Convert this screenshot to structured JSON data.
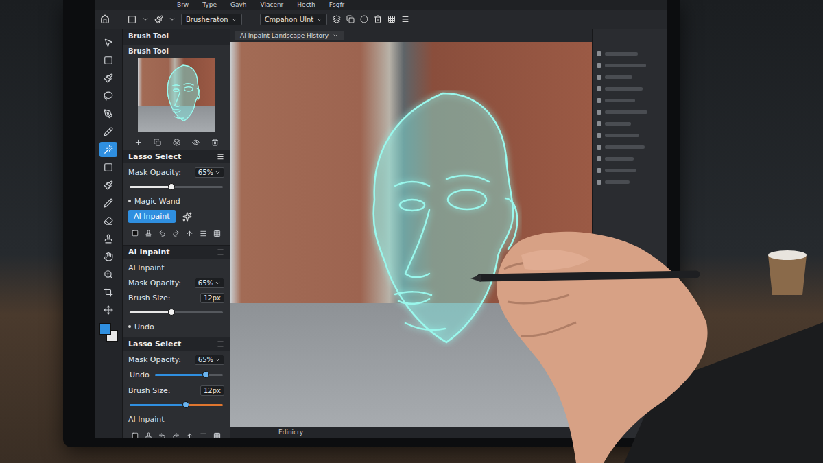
{
  "menu": [
    "Brw",
    "Type",
    "Gavh",
    "Viacenr",
    "Hecth",
    "Fsgfr"
  ],
  "options_bar": {
    "preset": "Brusheraton",
    "mode": "Cmpahon Ulnt"
  },
  "tools": [
    {
      "kind": "pointer",
      "selected": false
    },
    {
      "kind": "marquee",
      "selected": false
    },
    {
      "kind": "brush",
      "selected": false
    },
    {
      "kind": "lasso",
      "selected": false
    },
    {
      "kind": "pen",
      "selected": false
    },
    {
      "kind": "pencil",
      "selected": false
    },
    {
      "kind": "wand",
      "selected": true
    },
    {
      "kind": "marquee",
      "selected": false
    },
    {
      "kind": "brush",
      "selected": false
    },
    {
      "kind": "pencil",
      "selected": false
    },
    {
      "kind": "eraser",
      "selected": false
    },
    {
      "kind": "stamp",
      "selected": false
    },
    {
      "kind": "hand",
      "selected": false
    },
    {
      "kind": "zoom",
      "selected": false
    },
    {
      "kind": "crop",
      "selected": false
    },
    {
      "kind": "move",
      "selected": false
    }
  ],
  "swatch": {
    "foreground": "#2f8fe0",
    "background": "#e8e8e8"
  },
  "document_tab": {
    "title": "AI Inpaint Landscape History"
  },
  "sidebar": {
    "header": "Brush Tool",
    "preview_title": "Brush Tool",
    "sections": [
      {
        "title": "Lasso Select",
        "rows": [
          {
            "kind": "select",
            "label": "Mask Opacity:",
            "value": "65%"
          },
          {
            "kind": "slider",
            "level": 0.45,
            "color": "#e8e8e8",
            "track": "#55585d"
          },
          {
            "kind": "bullet",
            "label": "Magic Wand"
          },
          {
            "kind": "button",
            "label": "AI Inpaint",
            "selected": true
          },
          {
            "kind": "icons"
          }
        ]
      },
      {
        "title": "AI Inpaint",
        "rows": [
          {
            "kind": "label",
            "label": "AI Inpaint"
          },
          {
            "kind": "select",
            "label": "Mask Opacity:",
            "value": "65%"
          },
          {
            "kind": "value",
            "label": "Brush Size:",
            "value": "12px"
          },
          {
            "kind": "slider",
            "level": 0.45,
            "color": "#e8e8e8",
            "track": "#55585d"
          },
          {
            "kind": "bullet",
            "label": "Undo"
          }
        ]
      },
      {
        "title": "Lasso Select",
        "rows": [
          {
            "kind": "select",
            "label": "Mask Opacity:",
            "value": "65%"
          },
          {
            "kind": "slider",
            "label": "Undo",
            "level": 0.75,
            "color": "#2f8fe0",
            "track": "#55585d"
          },
          {
            "kind": "value",
            "label": "Brush Size:",
            "value": "12px"
          },
          {
            "kind": "slider",
            "level": 0.6,
            "color": "#2f8fe0",
            "track": "#e0762f"
          },
          {
            "kind": "label",
            "label": "AI Inpaint"
          },
          {
            "kind": "icons"
          }
        ]
      }
    ]
  },
  "status_bar": {
    "text": "Edinicry"
  }
}
